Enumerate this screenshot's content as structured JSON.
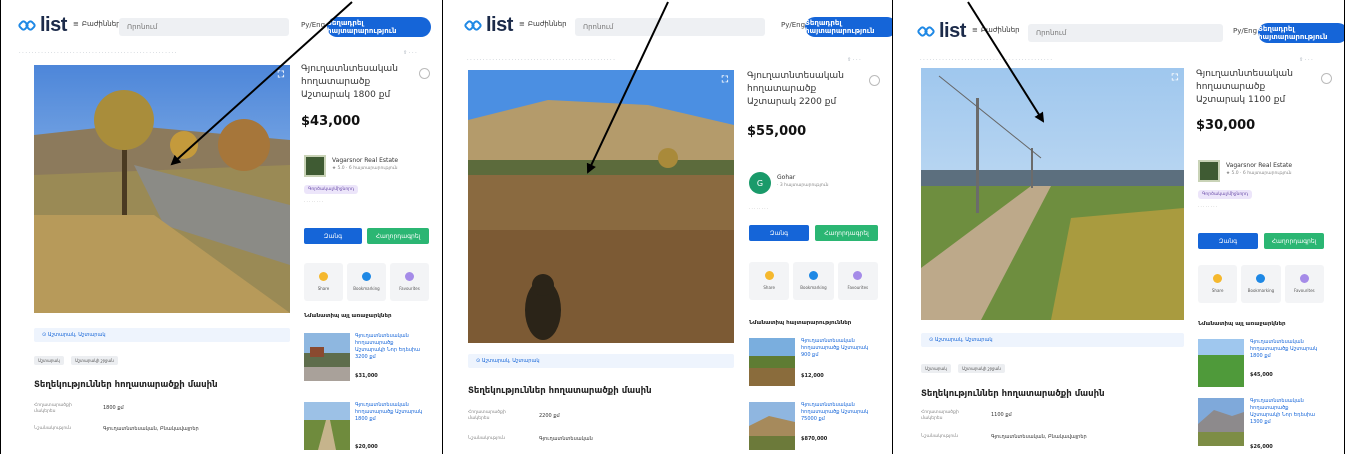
{
  "header": {
    "logo_text": "list",
    "categories_label": "Բաժիններ",
    "search_placeholder": "Որոնում",
    "lang": "Ру/Eng",
    "post_button": "Տեղադրել հայտարարություն"
  },
  "panels": [
    {
      "title": "Գյուղատնտեսական հողատարածք Աշտարակ 1800 քմ",
      "price": "$43,000",
      "seller_name": "Vagarsnor Real Estate",
      "seller_rating": "★ 5.0 · 6 հայտարարություն",
      "seller_tag": "Գործակալ/միջնորդ",
      "call": "Զանգ",
      "message": "Հաղորդագրել",
      "actions": [
        "Share",
        "Bookmarking",
        "Favourites"
      ],
      "related_title": "Նմանատիպ այլ առաջարկներ",
      "related": [
        {
          "text": "Գյուղատնտեսական հողատարածք Աշտարակի Նոր Եդեսիա 3200 քմ",
          "price": "$31,000"
        },
        {
          "text": "Գյուղատնտեսական հողատարածք Աշտարակ 1800 քմ",
          "price": "$20,000"
        }
      ],
      "address": "Աշտարակ, Աշտարակ",
      "chips": [
        "Աշտարակ",
        "Աշտարակի շրջան"
      ],
      "section_title": "Տեղեկություններ հողատարածքի մասին",
      "spec1_k": "Հողատարածքի մակերես",
      "spec1_v": "1800 քմ",
      "spec2_k": "Նշանակություն",
      "spec2_v": "Գյուղատնտեսական, Բնակավայրեր"
    },
    {
      "title": "Գյուղատնտեսական հողատարածք Աշտարակ 2200 քմ",
      "price": "$55,000",
      "seller_name": "Gohar",
      "seller_rating": "· 3 հայտարարություն",
      "call": "Զանգ",
      "message": "Հաղորդագրել",
      "actions": [
        "Share",
        "Bookmarking",
        "Favourites"
      ],
      "related_title": "Նմանատիպ հայտարարություններ",
      "related": [
        {
          "text": "Գյուղատնտեսական հողատարածք Աշտարակ 900 քմ",
          "price": "$12,000"
        },
        {
          "text": "Գյուղատնտեսական հողատարածք Աշտարակ 75000 քմ",
          "price": "$870,000"
        }
      ],
      "address": "Աշտարակ, Աշտարակ",
      "section_title": "Տեղեկություններ հողատարածքի մասին",
      "spec1_k": "Հողատարածքի մակերես",
      "spec1_v": "2200 քմ",
      "spec2_k": "Նշանակություն",
      "spec2_v": "Գյուղատնտեսական"
    },
    {
      "title": "Գյուղատնտեսական հողատարածք Աշտարակ 1100 քմ",
      "price": "$30,000",
      "seller_name": "Vagarsnor Real Estate",
      "seller_rating": "★ 5.0 · 6 հայտարարություն",
      "seller_tag": "Գործակալ/միջնորդ",
      "call": "Զանգ",
      "message": "Հաղորդագրել",
      "actions": [
        "Share",
        "Bookmarking",
        "Favourites"
      ],
      "related_title": "Նմանատիպ այլ առաջարկներ",
      "related": [
        {
          "text": "Գյուղատնտեսական հողատարածք Աշտարակ 1800 քմ",
          "price": "$45,000"
        },
        {
          "text": "Գյուղատնտեսական հողատարածք Աշտարակի Նոր Եդեսիա 1300 քմ",
          "price": "$26,000"
        }
      ],
      "address": "Աշտարակ, Աշտարակ",
      "chips": [
        "Աշտարակ",
        "Աշտարակի շրջան"
      ],
      "section_title": "Տեղեկություններ հողատարածքի մասին",
      "spec1_k": "Հողատարածքի մակերես",
      "spec1_v": "1100 քմ",
      "spec2_k": "Նշանակություն",
      "spec2_v": "Գյուղատնտեսական, Բնակավայրեր"
    }
  ],
  "colors": {
    "brand_blue": "#1565d8",
    "message_green": "#2bb673",
    "arrow": "#000000"
  }
}
